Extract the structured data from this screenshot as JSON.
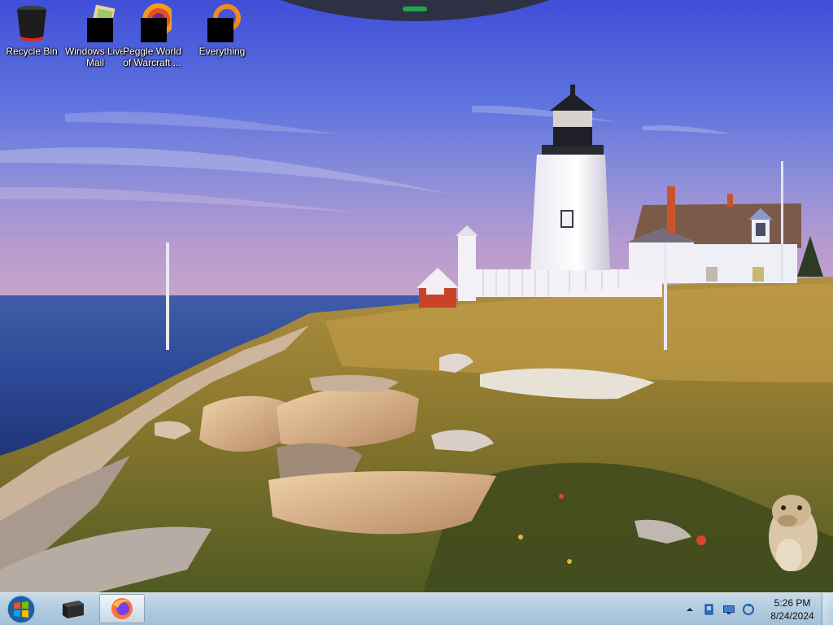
{
  "desktop": {
    "icons": [
      {
        "label": "Recycle Bin",
        "icon": "recycle-bin-icon"
      },
      {
        "label": "Windows Live Mail",
        "icon": "windows-live-mail-icon"
      },
      {
        "label": "Peggle World of Warcraft ...",
        "icon": "peggle-icon"
      },
      {
        "label": "Everything",
        "icon": "everything-search-icon"
      }
    ]
  },
  "taskbar": {
    "items": [
      {
        "icon": "start-orb-icon"
      },
      {
        "icon": "app-box-icon"
      },
      {
        "icon": "firefox-icon"
      }
    ],
    "tray": {
      "icons": [
        "show-hidden-icons-chevron",
        "network-icon",
        "display-icon",
        "sync-icon"
      ],
      "time": "5:26 PM",
      "date": "8/24/2024"
    }
  },
  "colors": {
    "taskbar": "#b3cce0",
    "sky": "#4a5fd0",
    "sea": "#2a3f8f"
  }
}
